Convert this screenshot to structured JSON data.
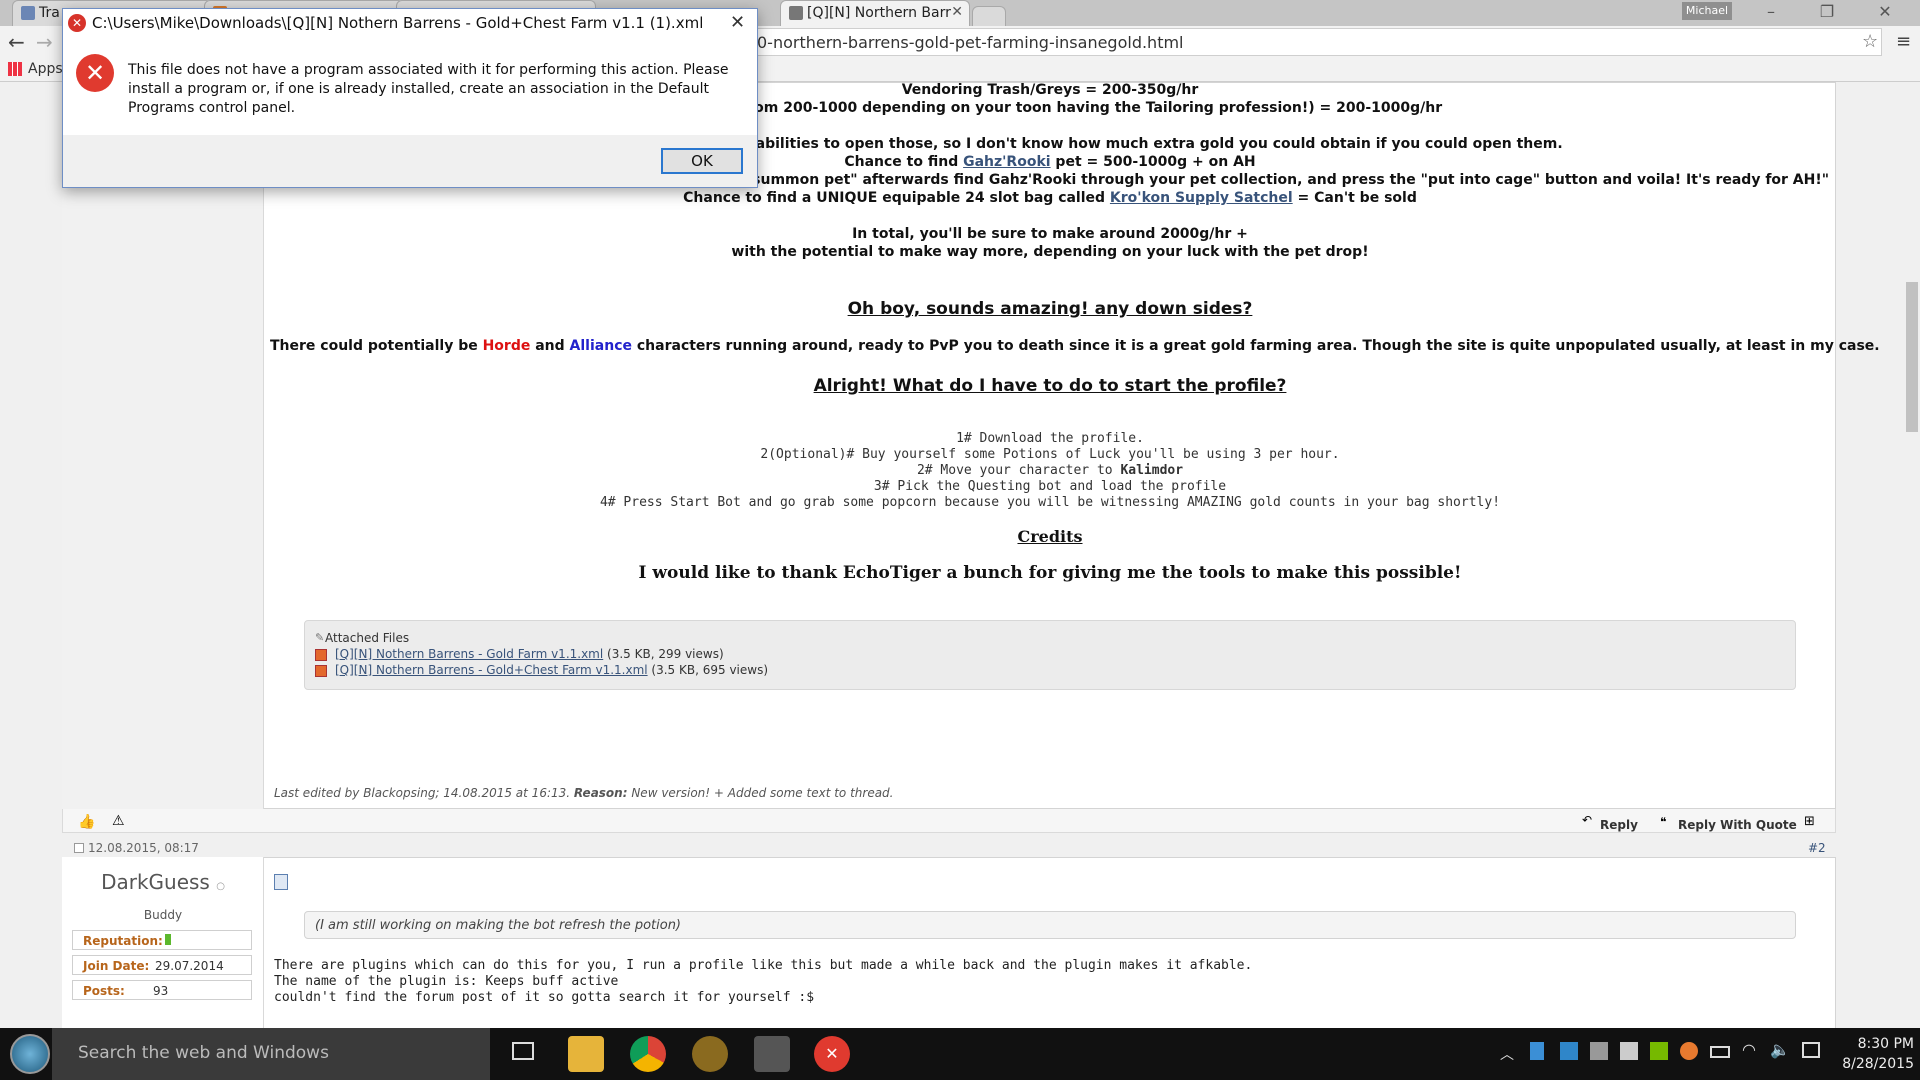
{
  "browser": {
    "tabs": [
      {
        "label": "Tra"
      },
      {
        "label": "[Q][N] Northern Barr"
      }
    ],
    "user": "Michael",
    "url": "0-northern-barrens-gold-pet-farming-insanegold.html",
    "bookmarks_apps": "Apps"
  },
  "post1": {
    "lines": [
      "Vendoring Trash/Greys = 200-350g/hr",
      "can range from 200-1000 depending on your toon having the Tailoring profession!) = 200-1000g/hr",
      "though I don't have the capabilities to open those, so I don't know how much extra gold you could obtain if you could open them."
    ],
    "pet_prefix": "Chance to find ",
    "pet_link": "Gahz'Rooki",
    "pet_suffix": " pet = 500-1000g + on AH",
    "cage_line": "to summon pet\" afterwards find Gahz'Rooki through your pet collection, and press the \"put into cage\" button and voila! It's ready for AH!\"",
    "bag_prefix": "Chance to find a UNIQUE equipable 24 slot bag called ",
    "bag_link": "Kro'kon Supply Satchel",
    "bag_suffix": " = Can't be sold",
    "total1": "In total, you'll be sure to make around 2000g/hr +",
    "total2": "with the potential to make way more, depending on your luck with the pet drop!",
    "h_downsides": "Oh boy, sounds amazing! any down sides?",
    "pvp_a": "There could potentially be ",
    "horde": "Horde",
    "and": " and ",
    "alliance": "Alliance",
    "pvp_b": " characters running around, ready to PvP you to death since it is a great gold farming area. Though the site is quite unpopulated usually, at least in my case.",
    "h_start": "Alright! What do I have to do to start the profile?",
    "steps": [
      "1# Download the profile.",
      "2(Optional)# Buy yourself some Potions of Luck you'll be using 3 per hour.",
      "3# Pick the Questing bot and load the profile",
      "4# Press Start Bot and go grab some popcorn because you will be witnessing AMAZING gold counts in your bag shortly!"
    ],
    "step3_prefix": "2# Move your character to ",
    "step3_bold": "Kalimdor",
    "h_credits": "Credits",
    "thanks": "I would like to thank EchoTiger a bunch for giving me the tools to make this possible!",
    "attach_title": "Attached Files",
    "files": [
      {
        "name": "[Q][N] Nothern Barrens - Gold Farm v1.1.xml",
        "meta": " (3.5 KB, 299 views)"
      },
      {
        "name": "[Q][N] Nothern Barrens - Gold+Chest Farm v1.1.xml",
        "meta": " (3.5 KB, 695 views)"
      }
    ],
    "edited_prefix": "Last edited by Blackopsing; 14.08.2015 at 16:13. ",
    "edited_reason_label": "Reason:",
    "edited_reason": " New version! + Added some text to thread.",
    "reply": "Reply",
    "reply_quote": "Reply With Quote"
  },
  "post2": {
    "date": "12.08.2015, 08:17",
    "number": "#2",
    "user": "DarkGuess",
    "rank": "Buddy",
    "rep_label": "Reputation:",
    "join_label": "Join Date:",
    "join_value": "29.07.2014",
    "posts_label": "Posts:",
    "posts_value": "93",
    "quote": "(I am still working on making the bot refresh the potion)",
    "body": [
      "There are plugins which can do this for you, I run a profile like this but made a while back and the plugin makes it afkable.",
      "The name of the plugin is: Keeps buff active",
      "couldn't find the forum post of it so gotta search it for yourself :$"
    ]
  },
  "dialog": {
    "title": "C:\\Users\\Mike\\Downloads\\[Q][N] Nothern Barrens - Gold+Chest Farm v1.1 (1).xml",
    "message": "This file does not have a program associated with it for performing this action. Please install a program or, if one is already installed, create an association in the Default Programs control panel.",
    "ok": "OK"
  },
  "taskbar": {
    "search": "Search the web and Windows",
    "time": "8:30 PM",
    "date": "8/28/2015"
  }
}
